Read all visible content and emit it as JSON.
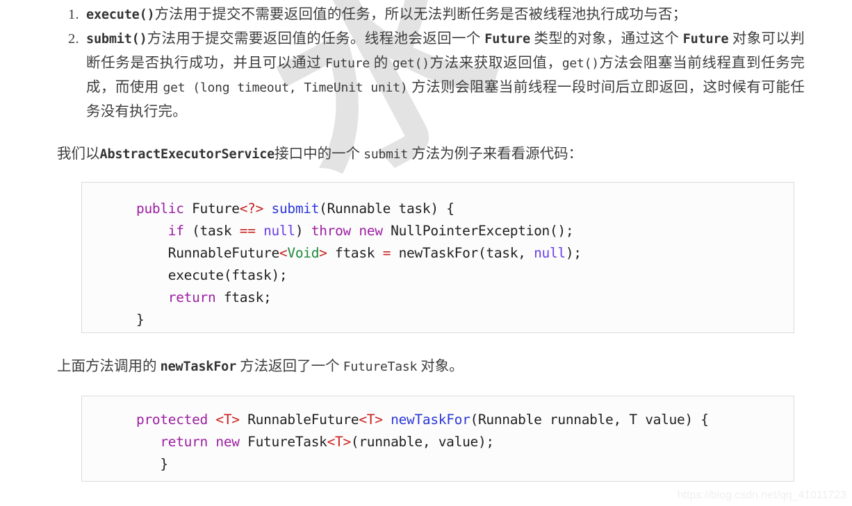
{
  "watermarks": {
    "background_glyph": "水",
    "url": "https://blog.csdn.net/qq_41011723"
  },
  "list": {
    "items": [
      {
        "number": "1.",
        "segments": [
          {
            "type": "code",
            "text": "execute()"
          },
          {
            "type": "text",
            "text": "方法用于提交不需要返回值的任务，所以无法判断任务是否被线程池执行成功与否；"
          }
        ]
      },
      {
        "number": "2.",
        "segments": [
          {
            "type": "code",
            "text": "submit()"
          },
          {
            "type": "text",
            "text": "方法用于提交需要返回值的任务。线程池会返回一个 "
          },
          {
            "type": "code",
            "text": "Future"
          },
          {
            "type": "text",
            "text": " 类型的对象，通过这个 "
          },
          {
            "type": "code",
            "text": "Future"
          },
          {
            "type": "text",
            "text": " 对象可以判断任务是否执行成功，并且可以通过 "
          },
          {
            "type": "code-reg",
            "text": "Future"
          },
          {
            "type": "text",
            "text": " 的 "
          },
          {
            "type": "code-reg",
            "text": "get()"
          },
          {
            "type": "text",
            "text": "方法来获取返回值，"
          },
          {
            "type": "code-reg",
            "text": "get()"
          },
          {
            "type": "text",
            "text": "方法会阻塞当前线程直到任务完成，而使用 "
          },
          {
            "type": "code-reg",
            "text": "get (long timeout, TimeUnit unit)"
          },
          {
            "type": "text",
            "text": " 方法则会阻塞当前线程一段时间后立即返回，这时候有可能任务没有执行完。"
          }
        ]
      }
    ]
  },
  "paragraphs": {
    "example_intro": {
      "prefix": "我们以",
      "code": "AbstractExecutorService",
      "middle": "接口中的一个 ",
      "code2": "submit",
      "suffix": " 方法为例子来看看源代码："
    },
    "newtaskfor_note": {
      "prefix": "上面方法调用的 ",
      "code": "newTaskFor",
      "middle": " 方法返回了一个 ",
      "code2": "FutureTask",
      "suffix": " 对象。"
    }
  },
  "code_blocks": {
    "submit": {
      "language": "java",
      "lines": [
        [
          {
            "t": "kw",
            "s": "public"
          },
          {
            "t": "plain",
            "s": " Future"
          },
          {
            "t": "op",
            "s": "<?>"
          },
          {
            "t": "plain",
            "s": " "
          },
          {
            "t": "fn",
            "s": "submit"
          },
          {
            "t": "plain",
            "s": "(Runnable task) {"
          }
        ],
        [
          {
            "t": "plain",
            "s": "    "
          },
          {
            "t": "kw",
            "s": "if"
          },
          {
            "t": "plain",
            "s": " (task "
          },
          {
            "t": "op",
            "s": "=="
          },
          {
            "t": "plain",
            "s": " "
          },
          {
            "t": "lit",
            "s": "null"
          },
          {
            "t": "plain",
            "s": ") "
          },
          {
            "t": "kw",
            "s": "throw new"
          },
          {
            "t": "plain",
            "s": " NullPointerException();"
          }
        ],
        [
          {
            "t": "plain",
            "s": "    RunnableFuture"
          },
          {
            "t": "op",
            "s": "<"
          },
          {
            "t": "type",
            "s": "Void"
          },
          {
            "t": "op",
            "s": ">"
          },
          {
            "t": "plain",
            "s": " ftask "
          },
          {
            "t": "op",
            "s": "="
          },
          {
            "t": "plain",
            "s": " newTaskFor(task, "
          },
          {
            "t": "lit",
            "s": "null"
          },
          {
            "t": "plain",
            "s": ");"
          }
        ],
        [
          {
            "t": "plain",
            "s": "    execute(ftask);"
          }
        ],
        [
          {
            "t": "plain",
            "s": "    "
          },
          {
            "t": "kw",
            "s": "return"
          },
          {
            "t": "plain",
            "s": " ftask;"
          }
        ],
        [
          {
            "t": "plain",
            "s": "}"
          }
        ]
      ]
    },
    "newtaskfor": {
      "language": "java",
      "lines": [
        [
          {
            "t": "kw",
            "s": "protected"
          },
          {
            "t": "plain",
            "s": " "
          },
          {
            "t": "op",
            "s": "<T>"
          },
          {
            "t": "plain",
            "s": " RunnableFuture"
          },
          {
            "t": "op",
            "s": "<T>"
          },
          {
            "t": "plain",
            "s": " "
          },
          {
            "t": "fn",
            "s": "newTaskFor"
          },
          {
            "t": "plain",
            "s": "(Runnable runnable, T value) {"
          }
        ],
        [
          {
            "t": "plain",
            "s": "   "
          },
          {
            "t": "kw",
            "s": "return new"
          },
          {
            "t": "plain",
            "s": " FutureTask"
          },
          {
            "t": "op",
            "s": "<T>"
          },
          {
            "t": "plain",
            "s": "(runnable, value);"
          }
        ],
        [
          {
            "t": "plain",
            "s": "   }"
          }
        ]
      ]
    }
  },
  "colors": {
    "keyword": "#9b1fa0",
    "function": "#2a36d8",
    "operator": "#c9211e",
    "type": "#1a8a3a",
    "literal": "#6a3de8",
    "plain": "#1f1f1f",
    "code_bg": "#fcfcfc",
    "code_border": "#dcdcdc",
    "body_text": "#3d3d3d",
    "watermark": "#e3e3e3"
  }
}
